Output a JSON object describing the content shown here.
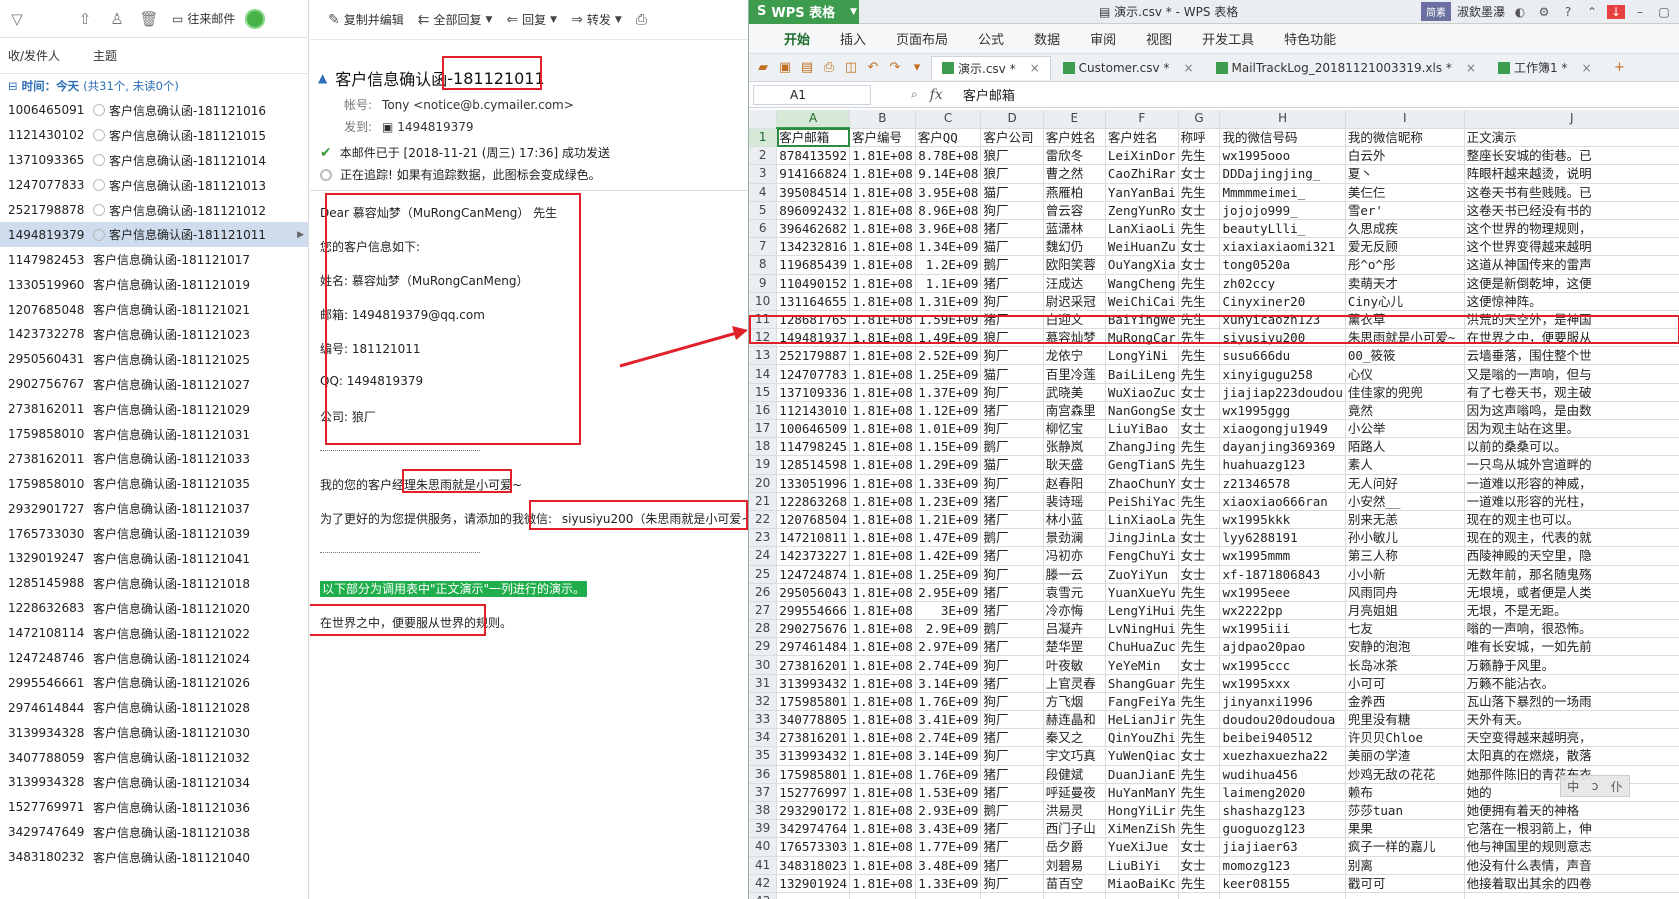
{
  "mail_list": {
    "toolbar": {
      "forward_tracking_label": "往来邮件"
    },
    "header": {
      "sender_col": "收/发件人",
      "subject_col": "主题"
    },
    "group": {
      "label": "时间：今天",
      "count": "(共31个, 未读0个)"
    },
    "rows": [
      {
        "sender": "1006465091",
        "subject": "客户信息确认函-181121016",
        "sent": true
      },
      {
        "sender": "1121430102",
        "subject": "客户信息确认函-181121015",
        "sent": true
      },
      {
        "sender": "1371093365",
        "subject": "客户信息确认函-181121014",
        "sent": true
      },
      {
        "sender": "1247077833",
        "subject": "客户信息确认函-181121013",
        "sent": true
      },
      {
        "sender": "2521798878",
        "subject": "客户信息确认函-181121012",
        "sent": true
      },
      {
        "sender": "1494819379",
        "subject": "客户信息确认函-181121011",
        "sent": true,
        "selected": true
      },
      {
        "sender": "1147982453",
        "subject": "客户信息确认函-181121017"
      },
      {
        "sender": "1330519960",
        "subject": "客户信息确认函-181121019"
      },
      {
        "sender": "1207685048",
        "subject": "客户信息确认函-181121021"
      },
      {
        "sender": "1423732278",
        "subject": "客户信息确认函-181121023"
      },
      {
        "sender": "2950560431",
        "subject": "客户信息确认函-181121025"
      },
      {
        "sender": "2902756767",
        "subject": "客户信息确认函-181121027"
      },
      {
        "sender": "2738162011",
        "subject": "客户信息确认函-181121029"
      },
      {
        "sender": "1759858010",
        "subject": "客户信息确认函-181121031"
      },
      {
        "sender": "2738162011",
        "subject": "客户信息确认函-181121033"
      },
      {
        "sender": "1759858010",
        "subject": "客户信息确认函-181121035"
      },
      {
        "sender": "2932901727",
        "subject": "客户信息确认函-181121037"
      },
      {
        "sender": "1765733030",
        "subject": "客户信息确认函-181121039"
      },
      {
        "sender": "1329019247",
        "subject": "客户信息确认函-181121041"
      },
      {
        "sender": "1285145988",
        "subject": "客户信息确认函-181121018"
      },
      {
        "sender": "1228632683",
        "subject": "客户信息确认函-181121020"
      },
      {
        "sender": "1472108114",
        "subject": "客户信息确认函-181121022"
      },
      {
        "sender": "1247248746",
        "subject": "客户信息确认函-181121024"
      },
      {
        "sender": "2995546661",
        "subject": "客户信息确认函-181121026"
      },
      {
        "sender": "2974614844",
        "subject": "客户信息确认函-181121028"
      },
      {
        "sender": "3139934328",
        "subject": "客户信息确认函-181121030"
      },
      {
        "sender": "3407788059",
        "subject": "客户信息确认函-181121032"
      },
      {
        "sender": "3139934328",
        "subject": "客户信息确认函-181121034"
      },
      {
        "sender": "1527769971",
        "subject": "客户信息确认函-181121036"
      },
      {
        "sender": "3429747649",
        "subject": "客户信息确认函-181121038"
      },
      {
        "sender": "3483180232",
        "subject": "客户信息确认函-181121040"
      }
    ]
  },
  "mail_view": {
    "toolbar": {
      "copy_edit": "复制并编辑",
      "reply_all": "全部回复",
      "reply": "回复",
      "forward": "转发"
    },
    "subject": "客户信息确认函",
    "subject_code": "-181121011",
    "from_key": "帐号:",
    "from_value": "Tony <notice@b.cymailer.com>",
    "to_key": "发到:",
    "to_value": "1494819379",
    "status_sent": "本邮件已于 [2018-11-21 (周三) 17:36] 成功发送",
    "status_tracking": "正在追踪! 如果有追踪数据，此图标会变成绿色。",
    "body": {
      "greeting": "Dear 慕容灿梦（MuRongCanMeng） 先生",
      "intro": "您的客户信息如下:",
      "name_line": "姓名: 慕容灿梦（MuRongCanMeng）",
      "email_line": "邮箱: 1494819379@qq.com",
      "code_line": "编号: 181121011",
      "qq_line": "QQ:  1494819379",
      "company_line": "公司: 狼厂",
      "manager_prefix": "我的您的客户经理",
      "manager_name": "朱思雨就是小可爱~",
      "wechat_prefix": "为了更好的为您提供服务，请添加的我微信:",
      "wechat_value": "siyusiyu200（朱思雨就是小可爱~",
      "green_note": "以下部分为调用表中\"正文演示\"一列进行的演示。",
      "demo_text": "在世界之中，便要服从世界的规则。"
    }
  },
  "wps": {
    "app_name": "WPS 表格",
    "doc_title": "演示.csv * - WPS 表格",
    "user_name": "淑欽墨瀑",
    "user_badge": "简素",
    "menu": [
      "开始",
      "插入",
      "页面布局",
      "公式",
      "数据",
      "审阅",
      "视图",
      "开发工具",
      "特色功能"
    ],
    "tabs": [
      "演示.csv *",
      "Customer.csv *",
      "MailTrackLog_20181121003319.xls *",
      "工作簿1 *"
    ],
    "name_box": "A1",
    "formula_value": "客户邮箱",
    "columns": [
      "A",
      "B",
      "C",
      "D",
      "E",
      "F",
      "G",
      "H",
      "I",
      "J"
    ],
    "header_row": [
      "客户邮箱",
      "客户编号",
      "客户QQ",
      "客户公司",
      "客户姓名",
      "客户姓名",
      "称呼",
      "我的微信号码",
      "我的微信昵称",
      "正文演示"
    ],
    "rows": [
      [
        "878413592",
        "1.81E+08",
        "8.78E+08",
        "狼厂",
        "雷欣冬",
        "LeiXinDor",
        "先生",
        "wx1995ooo",
        "白云外",
        "整座长安城的街巷。已"
      ],
      [
        "914166824",
        "1.81E+08",
        "9.14E+08",
        "狼厂",
        "曹之然",
        "CaoZhiRar",
        "女士",
        "DDDajingjing_",
        "夏丶",
        "阵眼杆越来越烫，说明"
      ],
      [
        "395084514",
        "1.81E+08",
        "3.95E+08",
        "猫厂",
        "燕雁柏",
        "YanYanBai",
        "先生",
        "Mmmmmeimei_",
        "美仨仨",
        "这卷天书有些贱贱。已"
      ],
      [
        "896092432",
        "1.81E+08",
        "8.96E+08",
        "狗厂",
        "曾云容",
        "ZengYunRo",
        "女士",
        "jojojo999_",
        "雪er'",
        "这卷天书已经没有书的"
      ],
      [
        "396462682",
        "1.81E+08",
        "3.96E+08",
        "猪厂",
        "蓝潇林",
        "LanXiaoLi",
        "先生",
        "beautyLlli_",
        "久思成疾",
        "这个世界的物理规则，"
      ],
      [
        "134232816",
        "1.81E+08",
        "1.34E+09",
        "猫厂",
        "魏幻仍",
        "WeiHuanZu",
        "女士",
        "xiaxiaxiaomi321",
        "爱无反顾",
        "这个世界变得越来越明"
      ],
      [
        "119685439",
        "1.81E+08",
        "1.2E+09",
        "鹅厂",
        "欧阳笑蓉",
        "OuYangXia",
        "女士",
        "tong0520a",
        "彤^o^彤",
        "这道从神国传来的雷声"
      ],
      [
        "110490152",
        "1.81E+08",
        "1.1E+09",
        "猪厂",
        "汪成达",
        "WangCheng",
        "先生",
        "zh02ccy",
        "卖萌天才",
        "这便是新倒乾坤，这便"
      ],
      [
        "131164655",
        "1.81E+08",
        "1.31E+09",
        "狗厂",
        "尉迟采冠",
        "WeiChiCai",
        "先生",
        "Cinyxiner20",
        "Ciny心儿",
        "这便惊神阵。"
      ],
      [
        "128681765",
        "1.81E+08",
        "1.59E+09",
        "猪厂",
        "白迎文",
        "BaiYingWe",
        "先生",
        "xunyicaozh123",
        "薰衣草",
        "洪荒的天空外，是神国"
      ],
      [
        "149481937",
        "1.81E+08",
        "1.49E+09",
        "狼厂",
        "慕容灿梦",
        "MuRongCar",
        "先生",
        "siyusiyu200",
        "朱思雨就是小可爱~",
        "在世界之中，便要服从"
      ],
      [
        "252179887",
        "1.81E+08",
        "2.52E+09",
        "狗厂",
        "龙依宁",
        "LongYiNi",
        "先生",
        "susu666du",
        "00_筱筱",
        "云墙垂落，围住整个世"
      ],
      [
        "124707783",
        "1.81E+08",
        "1.25E+09",
        "猫厂",
        "百里冷莲",
        "BaiLiLeng",
        "先生",
        "xinyigugu258",
        "心仪",
        "又是嗡的一声响，但与"
      ],
      [
        "137109336",
        "1.81E+08",
        "1.37E+09",
        "狗厂",
        "武晓美",
        "WuXiaoZuc",
        "女士",
        "jiajiap223doudou",
        "佳佳家的兜兜",
        "有了七卷天书，观主破"
      ],
      [
        "112143010",
        "1.81E+08",
        "1.12E+09",
        "猪厂",
        "南宫森里",
        "NanGongSe",
        "女士",
        "wx1995ggg",
        "竟然",
        "因为这声嗡鸣，是由数"
      ],
      [
        "100646509",
        "1.81E+08",
        "1.01E+09",
        "狗厂",
        "柳忆宝",
        "LiuYiBao",
        "女士",
        "xiaogongju1949",
        "小公举",
        "因为观主站在这里。"
      ],
      [
        "114798245",
        "1.81E+08",
        "1.15E+09",
        "鹅厂",
        "张静岚",
        "ZhangJing",
        "先生",
        "dayanjing369369",
        "陌路人",
        "以前的桑桑可以。"
      ],
      [
        "128514598",
        "1.81E+08",
        "1.29E+09",
        "猫厂",
        "耿天盛",
        "GengTianS",
        "先生",
        "huahuazg123",
        "素人",
        "一只鸟从城外宫道畔的"
      ],
      [
        "133051996",
        "1.81E+08",
        "1.33E+09",
        "狗厂",
        "赵春阳",
        "ZhaoChunY",
        "女士",
        "z21346578",
        "无人问好",
        "一道难以形容的神威，"
      ],
      [
        "122863268",
        "1.81E+08",
        "1.23E+09",
        "猪厂",
        "裴诗瑶",
        "PeiShiYac",
        "先生",
        "xiaoxiao666ran",
        "小安然__",
        "一道难以形容的光柱，"
      ],
      [
        "120768504",
        "1.81E+08",
        "1.21E+09",
        "猪厂",
        "林小蓝",
        "LinXiaoLa",
        "先生",
        "wx1995kkk",
        "别来无恙",
        "现在的观主也可以。"
      ],
      [
        "147210811",
        "1.81E+08",
        "1.47E+09",
        "鹅厂",
        "景劲澜",
        "JingJinLa",
        "女士",
        "lyy6288191",
        "孙小敏儿",
        "现在的观主，代表的就"
      ],
      [
        "142373227",
        "1.81E+08",
        "1.42E+09",
        "猪厂",
        "冯初亦",
        "FengChuYi",
        "女士",
        "wx1995mmm",
        "第三人称",
        "西陵神殿的天空里，隐"
      ],
      [
        "124724874",
        "1.81E+08",
        "1.25E+09",
        "狗厂",
        "滕一云",
        "ZuoYiYun",
        "女士",
        "xf-1871806843",
        "小小新",
        "无数年前，那名随鬼殇"
      ],
      [
        "295056043",
        "1.81E+08",
        "2.95E+09",
        "猪厂",
        "袁雪元",
        "YuanXueYu",
        "先生",
        "wx1995eee",
        "风雨同舟",
        "无垠境，或者便是人类"
      ],
      [
        "299554666",
        "1.81E+08",
        "3E+09",
        "猪厂",
        "冷亦悔",
        "LengYiHui",
        "先生",
        "wx2222pp",
        "月亮姐姐",
        "无垠，不是无距。"
      ],
      [
        "290275676",
        "1.81E+08",
        "2.9E+09",
        "鹅厂",
        "吕凝卉",
        "LvNingHui",
        "先生",
        "wx1995iii",
        "七友",
        "嗡的一声响，很恐怖。"
      ],
      [
        "297461484",
        "1.81E+08",
        "2.97E+09",
        "猪厂",
        "楚华罡",
        "ChuHuaZuc",
        "先生",
        "ajdpao20pao",
        "安静的泡泡",
        "唯有长安城，一如先前"
      ],
      [
        "273816201",
        "1.81E+08",
        "2.74E+09",
        "狗厂",
        "叶夜敏",
        "YeYeMin",
        "女士",
        "wx1995ccc",
        "长岛冰茶",
        "万籁静于风里。"
      ],
      [
        "313993432",
        "1.81E+08",
        "3.14E+09",
        "猪厂",
        "上官灵春",
        "ShangGuar",
        "先生",
        "wx1995xxx",
        "小可可",
        "万籁不能沾衣。"
      ],
      [
        "175985801",
        "1.81E+08",
        "1.76E+09",
        "狗厂",
        "方飞烟",
        "FangFeiYa",
        "先生",
        "jinyanxi1996",
        "金养西",
        "瓦山落下暴烈的一场雨"
      ],
      [
        "340778805",
        "1.81E+08",
        "3.41E+09",
        "狗厂",
        "赫连晶和",
        "HeLianJir",
        "先生",
        "doudou20doudoua",
        "兜里没有糖",
        "天外有天。"
      ],
      [
        "273816201",
        "1.81E+08",
        "2.74E+09",
        "猪厂",
        "秦又之",
        "QinYouZhi",
        "先生",
        "beibei940512",
        "许贝贝Chloe",
        "天空变得越来越明亮，"
      ],
      [
        "313993432",
        "1.81E+08",
        "3.14E+09",
        "狗厂",
        "宇文巧真",
        "YuWenQiac",
        "女士",
        "xuezhaxuezha22",
        "美丽の学渣",
        "太阳真的在燃烧，散落"
      ],
      [
        "175985801",
        "1.81E+08",
        "1.76E+09",
        "猪厂",
        "段健斌",
        "DuanJianE",
        "先生",
        "wudihua456",
        "炒鸡无敌の花花",
        "她那件陈旧的青花布衣"
      ],
      [
        "152776997",
        "1.81E+08",
        "1.53E+09",
        "猪厂",
        "呼延曼夜",
        "HuYanManY",
        "先生",
        "laimeng2020",
        "赖布",
        "她的"
      ],
      [
        "293290172",
        "1.81E+08",
        "2.93E+09",
        "鹅厂",
        "洪易灵",
        "HongYiLir",
        "先生",
        "shashazg123",
        "莎莎tuan",
        "她便拥有着天的神格"
      ],
      [
        "342974764",
        "1.81E+08",
        "3.43E+09",
        "猪厂",
        "西门子山",
        "XiMenZiSh",
        "先生",
        "guoguozg123",
        "果果",
        "它落在一根羽箭上，伸"
      ],
      [
        "176573303",
        "1.81E+08",
        "1.77E+09",
        "猪厂",
        "岳夕爵",
        "YueXiJue",
        "女士",
        "jiajiaer63",
        "疯子一样的嘉儿",
        "他与神国里的规则意志"
      ],
      [
        "348318023",
        "1.81E+08",
        "3.48E+09",
        "猪厂",
        "刘碧易",
        "LiuBiYi",
        "女士",
        "momozg123",
        "别离",
        "他没有什么表情，声音"
      ],
      [
        "132901924",
        "1.81E+08",
        "1.33E+09",
        "狗厂",
        "苗百空",
        "MiaoBaiKc",
        "先生",
        "keer08155",
        "戳可可",
        "他接着取出其余的四卷"
      ]
    ],
    "highlight_row_index": 11
  },
  "ime": {
    "chars": [
      "中",
      "ↄ",
      "仆"
    ]
  },
  "colors": {
    "wps_green": "#3e9c4f",
    "mark_red": "#e0202a",
    "mail_blue": "#2d6db5"
  }
}
